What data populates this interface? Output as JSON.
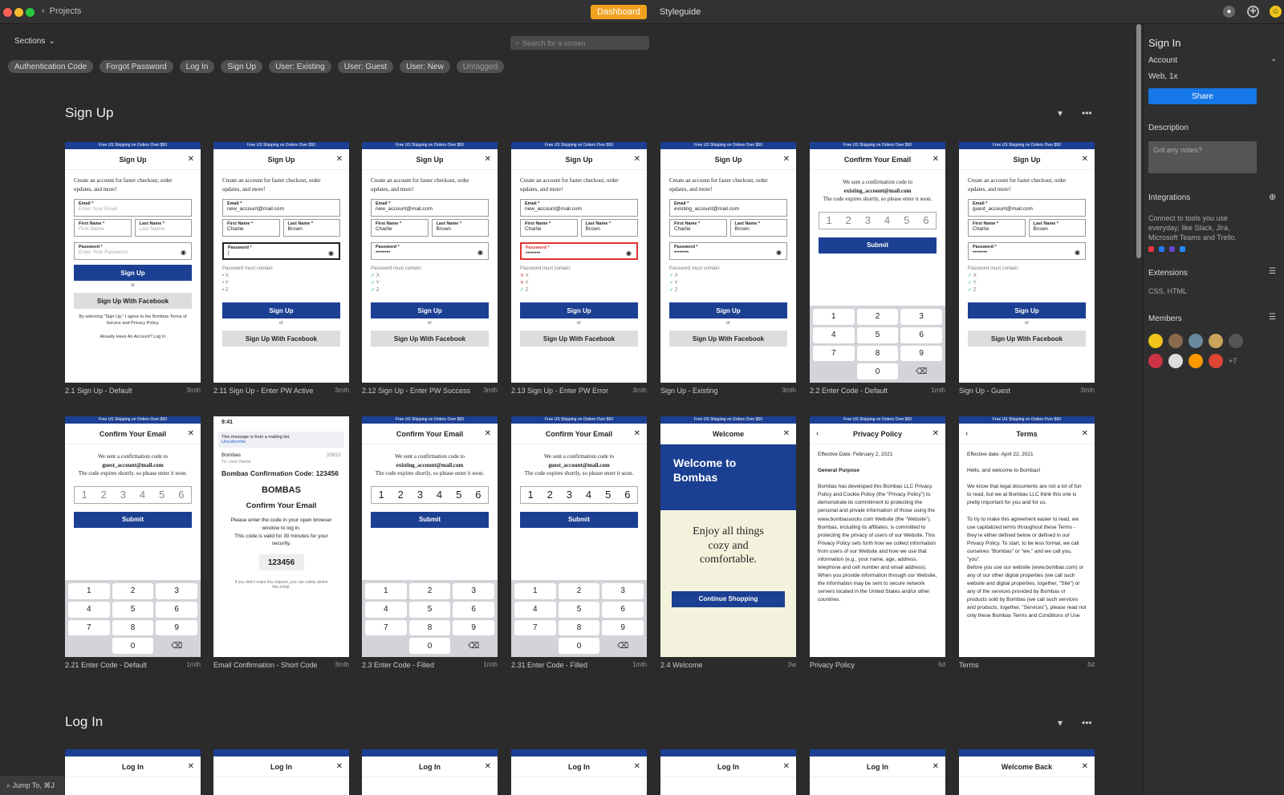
{
  "app": {
    "back": "Projects",
    "tabs": [
      "Dashboard",
      "Styleguide"
    ],
    "search_placeholder": "Search for a screen",
    "sections_label": "Sections",
    "jump": "Jump To, ⌘J"
  },
  "tags": [
    "Authentication Code",
    "Forgot Password",
    "Log In",
    "Sign Up",
    "User: Existing",
    "User: Guest",
    "User: New",
    "Untagged"
  ],
  "sections": [
    {
      "title": "Sign Up"
    },
    {
      "title": "Log In"
    }
  ],
  "banner": "Free US Shipping on Orders Over $50",
  "signup_intro": "Create an account for faster checkout, order updates, and more!",
  "labels": {
    "email": "Email *",
    "first": "First Name *",
    "last": "Last Name *",
    "password": "Password *",
    "signup": "Sign Up",
    "or": "or",
    "fb": "Sign Up With Facebook",
    "pw_req": "Password must contain:",
    "submit": "Submit",
    "login": "Log In"
  },
  "values": {
    "email_ph": "Enter Your Email",
    "first_ph": "First Name",
    "last_ph": "Last Name",
    "pw_ph": "Enter Your Password",
    "new_email": "new_account@mail.com",
    "existing_email": "existing_account@mail.com",
    "guest_email": "guest_account@mail.com",
    "first": "Charlie",
    "last": "Brown",
    "pw_mask": "••••••••"
  },
  "legal": "By selecting \"Sign Up,\" I agree to the Bombas Terms of Service and Privacy Policy.",
  "have_account": "Already Have An Account? Log In",
  "confirm": {
    "title": "Confirm Your Email",
    "sent": "We sent a confirmation code to",
    "expires": "The code expires shortly, so please enter it soon.",
    "digits": [
      "1",
      "2",
      "3",
      "4",
      "5",
      "6"
    ]
  },
  "keypad": [
    [
      "1",
      ""
    ],
    [
      "2",
      "ABC"
    ],
    [
      "3",
      "DEF"
    ],
    [
      "4",
      "GHI"
    ],
    [
      "5",
      "JKL"
    ],
    [
      "6",
      "MNO"
    ],
    [
      "7",
      "PQRS"
    ],
    [
      "8",
      "TUV"
    ],
    [
      "9",
      "WXYZ"
    ],
    [
      "",
      ""
    ],
    [
      "0",
      ""
    ],
    [
      "⌫",
      ""
    ]
  ],
  "email_screen": {
    "time": "9:41",
    "notice": "This message is from a mailing list.",
    "unsub": "Unsubscribe",
    "from": "Bombas",
    "to": "To: User Name",
    "date": "2/9/21",
    "subject": "Bombas Confirmation Code: 123456",
    "brand": "BOMBAS",
    "heading": "Confirm Your Email",
    "body1": "Please enter the code in your open browser window to log in.",
    "body2": "This code is valid for 30 minutes for your security.",
    "code": "123456",
    "footer": "If you didn't make this request, you can safely delete this email."
  },
  "welcome": {
    "title": "Welcome",
    "line1": "Welcome to",
    "line2": "Bombas",
    "tag1": "Enjoy all things",
    "tag2": "cozy and",
    "tag3": "comfortable.",
    "cta": "Continue Shopping"
  },
  "privacy": {
    "title": "Privacy Policy",
    "date": "Effective Date: February 2, 2021",
    "purpose": "General Purpose",
    "body": "Bombas has developed this Bombas LLC Privacy Policy and Cookie Policy (the \"Privacy Policy\") to demonstrate its commitment to protecting the personal and private information of those using the www.bombassocks.com Website (the \"Website\"). Bombas, including its affiliates, is committed to protecting the privacy of users of our Website. This Privacy Policy sets forth how we collect information from users of our Website and how we use that information (e.g., your name, age, address, telephone and cell number and email address). When you provide information through our Website, the information may be sent to secure network servers located in the United States and/or other countries."
  },
  "terms": {
    "title": "Terms",
    "date": "Effective date: April 22, 2021",
    "hello": "Hello, and welcome to Bombas!",
    "p1": "We know that legal documents are not a lot of fun to read, but we at Bombas LLC think this one is pretty important for you and for us.",
    "p2": "To try to make this agreement easier to read, we use capitalized terms throughout these Terms - they're either defined below or defined in our Privacy Policy. To start, to be less formal, we call ourselves \"Bombas\" or \"we,\" and we call you, \"you\".",
    "p3": "Before you use our website (www.bombas.com) or any of our other digital properties (we call such website and digital properties, together, \"Site\") or any of the services provided by Bombas or products sold by Bombas (we call such services and products, together, \"Services\"), please read not only these Bombas Terms and Conditions of Use"
  },
  "login_titles": [
    "Log In",
    "Log In",
    "Log In",
    "Log In",
    "Log In",
    "Log In",
    "Welcome Back"
  ],
  "row1": [
    {
      "name": "2.1 Sign Up - Default",
      "time": "3mth"
    },
    {
      "name": "2.11 Sign Up - Enter PW Active",
      "time": "3mth"
    },
    {
      "name": "2.12 Sign Up - Enter PW Success",
      "time": "3mth"
    },
    {
      "name": "2.13 Sign Up - Enter PW Error",
      "time": "3mth"
    },
    {
      "name": "Sign Up - Existing",
      "time": "3mth"
    },
    {
      "name": "2.2 Enter Code - Default",
      "time": "1mth"
    },
    {
      "name": "Sign Up - Guest",
      "time": "3mth"
    }
  ],
  "row2": [
    {
      "name": "2.21 Enter Code - Default",
      "time": "1mth"
    },
    {
      "name": "Email Confirmation - Short Code",
      "time": "3mth"
    },
    {
      "name": "2.3 Enter Code - Filled",
      "time": "1mth"
    },
    {
      "name": "2.31 Enter Code - Filled",
      "time": "1mth"
    },
    {
      "name": "2.4 Welcome",
      "time": "3w"
    },
    {
      "name": "Privacy Policy",
      "time": "6d"
    },
    {
      "name": "Terms",
      "time": "6d"
    }
  ],
  "panel": {
    "title": "Sign In",
    "account": "Account",
    "platform": "Web, 1x",
    "share": "Share",
    "description": "Description",
    "notes_ph": "Got any notes?",
    "integrations": "Integrations",
    "integrations_text": "Connect to tools you use everyday; like Slack, Jira, Microsoft Teams and Trello.",
    "extensions": "Extensions",
    "extensions_text": "CSS, HTML",
    "members": "Members",
    "more": "+7"
  },
  "colors": {
    "accent": "#f0a21f",
    "brand_blue": "#1b3f92",
    "share_blue": "#1677e6"
  }
}
